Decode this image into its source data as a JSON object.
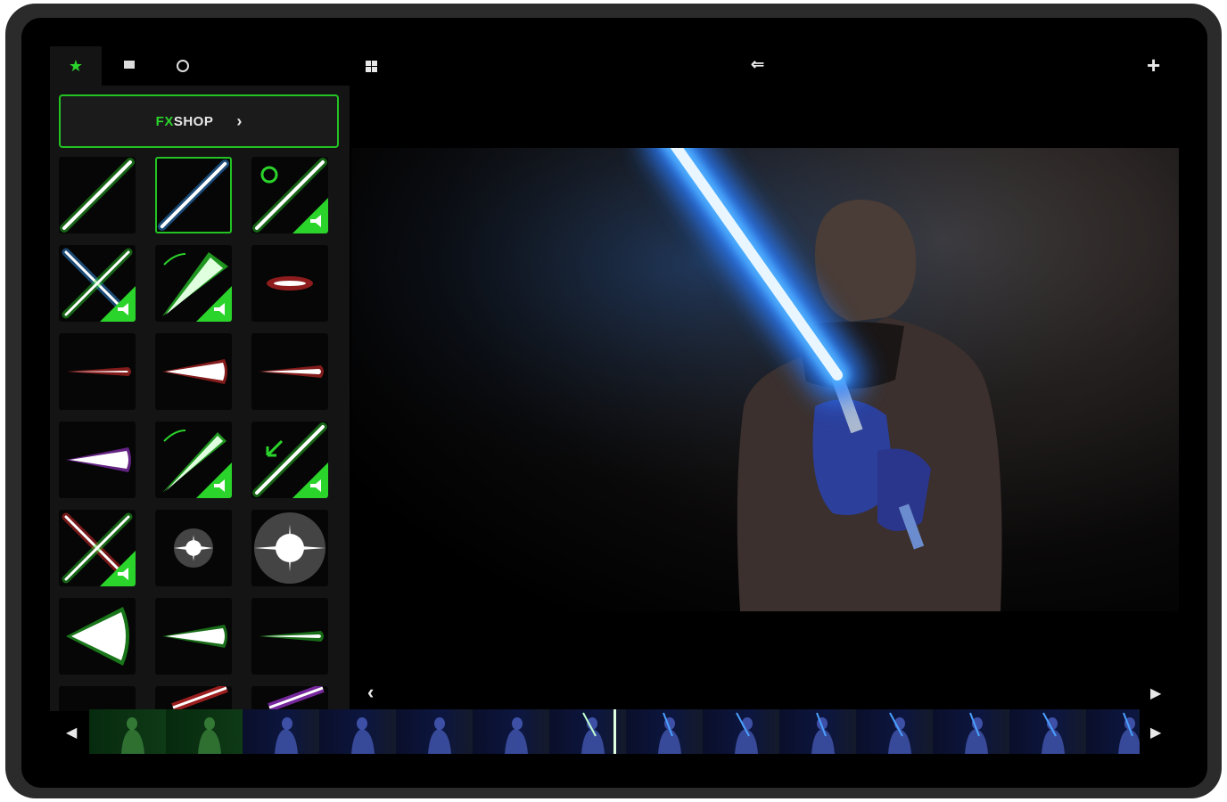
{
  "tabs": [
    {
      "name": "favorites-tab",
      "icon": "star-icon",
      "glyph": "★",
      "active": true
    },
    {
      "name": "library-tab",
      "icon": "film-icon",
      "glyph": "",
      "active": false
    },
    {
      "name": "settings-tab",
      "icon": "circle-icon",
      "glyph": "",
      "active": false
    }
  ],
  "fxshop": {
    "label_accent": "FX",
    "label_main": "SHOP",
    "chevron": "›"
  },
  "toolbar": {
    "layout_icon": "grid-icon",
    "swap_icon": "swap-arrows-icon",
    "swap_glyph": "⇐",
    "add_icon": "plus-icon",
    "add_glyph": "+"
  },
  "effects": [
    {
      "name": "green-saber",
      "selected": false
    },
    {
      "name": "blue-saber",
      "selected": true
    },
    {
      "name": "green-spin-saber",
      "selected": false
    },
    {
      "name": "crossed-sabers",
      "selected": false
    },
    {
      "name": "green-swing-saber",
      "selected": false
    },
    {
      "name": "red-short-blast",
      "selected": false
    },
    {
      "name": "red-blaster-thin",
      "selected": false
    },
    {
      "name": "red-blaster-wide",
      "selected": false
    },
    {
      "name": "red-blaster-medium",
      "selected": false
    },
    {
      "name": "purple-blast",
      "selected": false
    },
    {
      "name": "green-swing-saber-2",
      "selected": false
    },
    {
      "name": "green-arrow-saber",
      "selected": false
    },
    {
      "name": "red-green-crossed",
      "selected": false
    },
    {
      "name": "white-flash-small",
      "selected": false
    },
    {
      "name": "white-flash-large",
      "selected": false
    },
    {
      "name": "green-blast-wide",
      "selected": false
    },
    {
      "name": "green-blast-medium",
      "selected": false
    },
    {
      "name": "green-blast-thin",
      "selected": false
    }
  ],
  "timeline": {
    "prev_glyph": "◀",
    "next_glyph": "▶",
    "back_glyph": "‹",
    "forward_glyph": "▶",
    "frame_count": 14,
    "playhead_frame": 7
  },
  "colors": {
    "accent": "#22c322",
    "saber_blue": "#3aa0ff",
    "saber_green": "#2bd42b"
  }
}
